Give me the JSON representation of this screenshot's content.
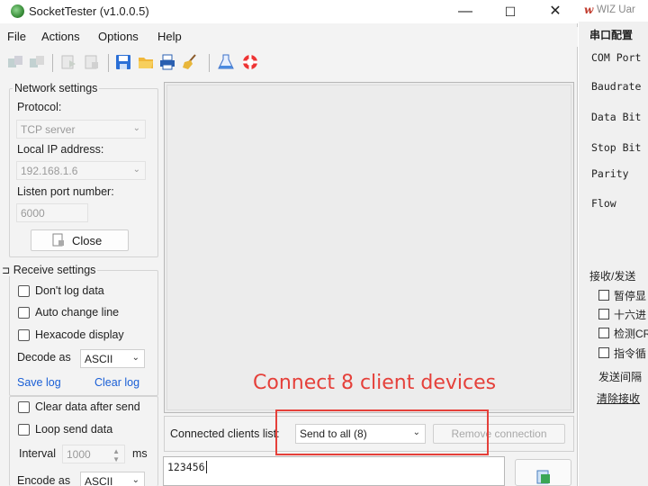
{
  "window": {
    "title": "SocketTester (v1.0.0.5)",
    "controls": {
      "minimize": "—",
      "maximize": "☐",
      "close": "✕"
    }
  },
  "menu": [
    "File",
    "Actions",
    "Options",
    "Help"
  ],
  "network_settings": {
    "group_title": "Network settings",
    "protocol_label": "Protocol:",
    "protocol_value": "TCP server",
    "local_ip_label": "Local IP address:",
    "local_ip_value": "192.168.1.6",
    "listen_port_label": "Listen port number:",
    "listen_port_value": "6000",
    "close_button": "Close"
  },
  "receive_settings": {
    "group_title": "Receive settings",
    "options": [
      "Don't log data",
      "Auto change line",
      "Hexacode display"
    ],
    "decode_label": "Decode as",
    "decode_value": "ASCII",
    "save_log": "Save log",
    "clear_log": "Clear log"
  },
  "send_settings": {
    "clear_after_send": "Clear data after send",
    "loop_send": "Loop send data",
    "interval_label": "Interval",
    "interval_value": "1000",
    "interval_unit": "ms",
    "encode_label": "Encode as",
    "encode_value": "ASCII"
  },
  "clients": {
    "label": "Connected clients list:",
    "selected": "Send to all (8)",
    "remove_button": "Remove connection"
  },
  "send_input": {
    "value": "123456"
  },
  "annotation": {
    "text": "Connect 8 client devices",
    "color": "#e5403a"
  },
  "right_window": {
    "title": "WIZ Uar",
    "section1": "串口配置",
    "fields": [
      "COM Port",
      "Baudrate",
      "Data Bit",
      "Stop Bit",
      "Parity",
      "Flow"
    ],
    "section2": "接收/发送",
    "options": [
      "暂停显",
      "十六进",
      "检测CR",
      "指令循"
    ],
    "interval_label": "发送间隔",
    "clear_label": "清除接收"
  }
}
